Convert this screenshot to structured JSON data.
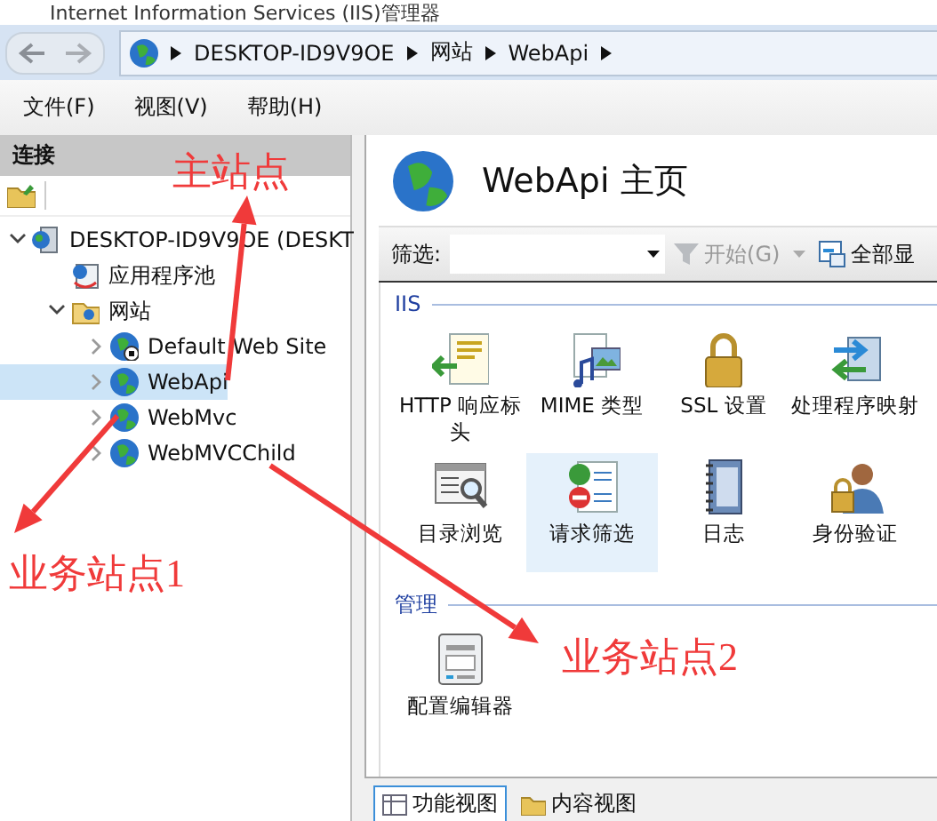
{
  "window": {
    "title": "Internet Information Services (IIS)管理器"
  },
  "address_bar": {
    "segments": [
      "DESKTOP-ID9V9OE",
      "网站",
      "WebApi"
    ]
  },
  "menu": [
    "文件(F)",
    "视图(V)",
    "帮助(H)"
  ],
  "connections": {
    "title": "连接",
    "tree": [
      {
        "label": "DESKTOP-ID9V9OE (DESKT",
        "kind": "server",
        "expanded": true,
        "selected": false,
        "children": [
          {
            "label": "应用程序池",
            "kind": "pool",
            "selected": false
          },
          {
            "label": "网站",
            "kind": "folder",
            "expanded": true,
            "selected": false,
            "children": [
              {
                "label": "Default Web Site",
                "kind": "stopped-site",
                "expanded": false,
                "selected": false
              },
              {
                "label": "WebApi",
                "kind": "site",
                "expanded": false,
                "selected": true
              },
              {
                "label": "WebMvc",
                "kind": "site",
                "expanded": false,
                "selected": false
              },
              {
                "label": "WebMVCChild",
                "kind": "site",
                "expanded": false,
                "selected": false
              }
            ]
          }
        ]
      }
    ]
  },
  "page": {
    "title": "WebApi 主页",
    "filter": {
      "label": "筛选:",
      "go": "开始(G)",
      "show_all": "全部显"
    },
    "groups": [
      {
        "title": "IIS",
        "features": [
          {
            "label": "HTTP 响应标头",
            "kind": "headers",
            "selected": false
          },
          {
            "label": "MIME 类型",
            "kind": "mime",
            "selected": false
          },
          {
            "label": "SSL 设置",
            "kind": "lock",
            "selected": false
          },
          {
            "label": "处理程序映射",
            "kind": "handlers",
            "selected": false
          },
          {
            "label": "目录浏览",
            "kind": "browse",
            "selected": false
          },
          {
            "label": "请求筛选",
            "kind": "filtering",
            "selected": true
          },
          {
            "label": "日志",
            "kind": "log",
            "selected": false
          },
          {
            "label": "身份验证",
            "kind": "auth",
            "selected": false
          }
        ]
      },
      {
        "title": "管理",
        "features": [
          {
            "label": "配置编辑器",
            "kind": "config",
            "selected": false
          }
        ]
      }
    ]
  },
  "view_tabs": [
    {
      "label": "功能视图",
      "selected": true
    },
    {
      "label": "内容视图",
      "selected": false
    }
  ],
  "annotations": [
    "主站点",
    "业务站点1",
    "业务站点2"
  ]
}
